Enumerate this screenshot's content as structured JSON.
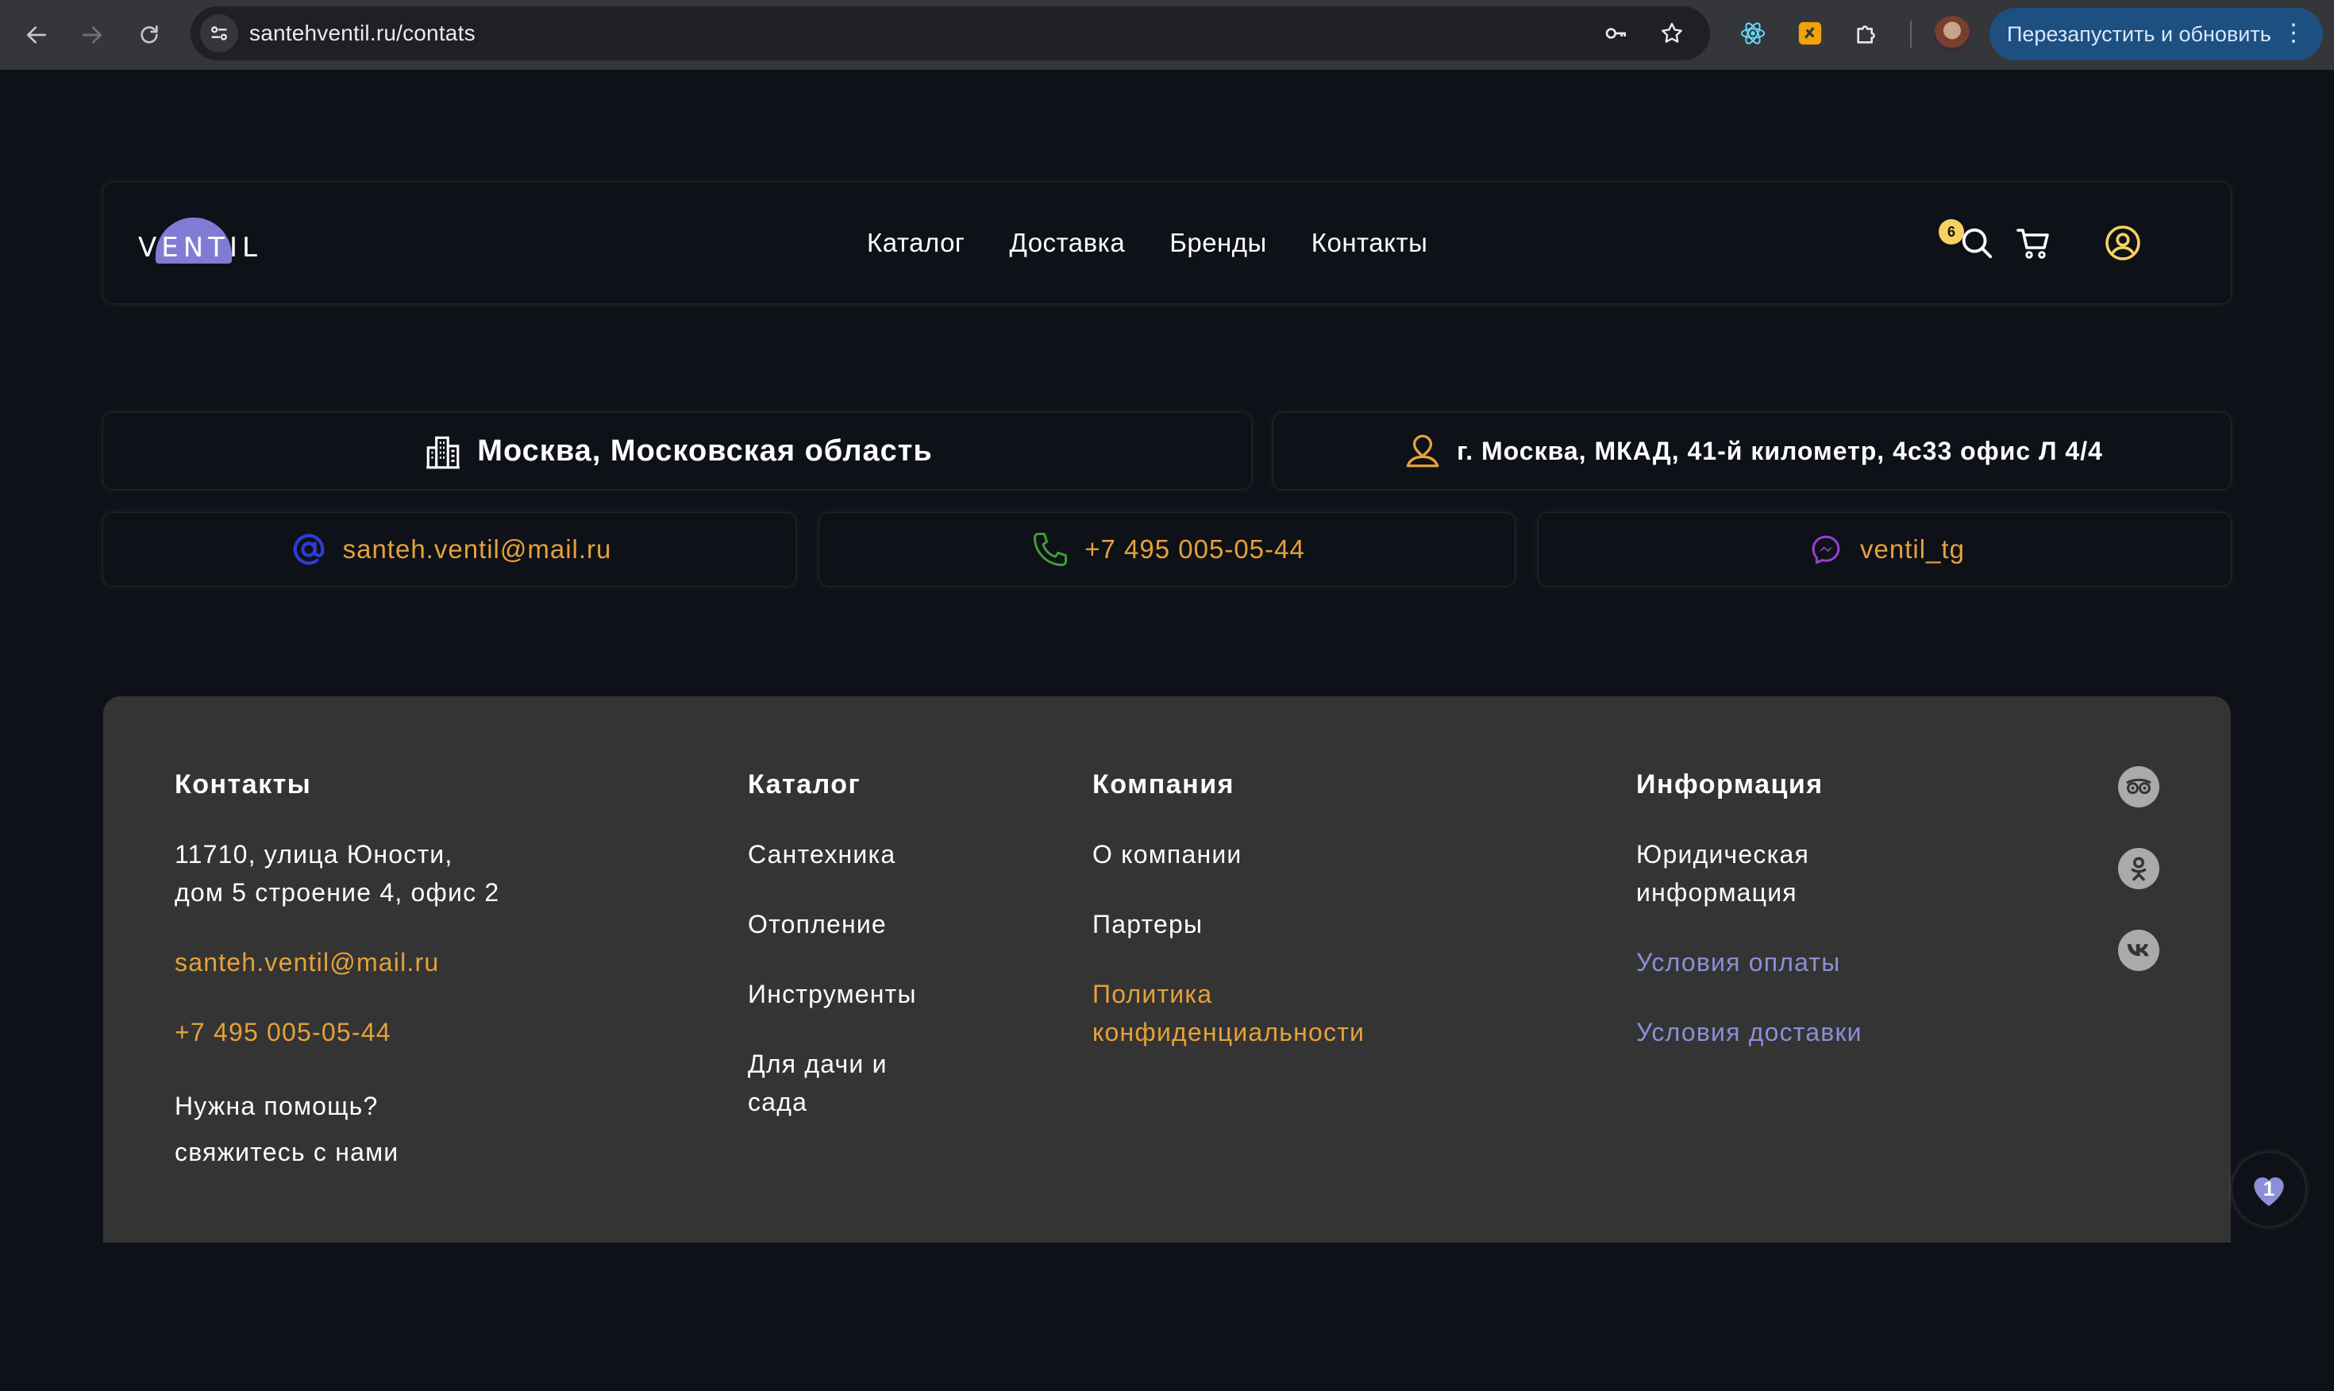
{
  "browser": {
    "url": "santehventil.ru/contats",
    "relaunch_label": "Перезапустить и обновить"
  },
  "header": {
    "logo_text": "VENTIL",
    "nav": [
      {
        "label": "Каталог"
      },
      {
        "label": "Доставка"
      },
      {
        "label": "Бренды"
      },
      {
        "label": "Контакты"
      }
    ],
    "cart_count": "6",
    "colors": {
      "cart_badge": "#f5d160",
      "logo_disc": "#8a86e6"
    }
  },
  "contacts": {
    "region": "Москва, Московская область",
    "address": "г. Москва, МКАД, 41-й километр, 4с33 офис Л 4/4",
    "email": "santeh.ventil@mail.ru",
    "phone": "+7 495 005-05-44",
    "telegram": "ventil_tg",
    "colors": {
      "accent": "#e5a13a",
      "email_icon": "#2f3bd6",
      "phone_icon": "#3f9a3a",
      "messenger_icon": "#9a3fd6",
      "address_icon": "#e5a13a"
    }
  },
  "footer": {
    "contacts": {
      "title": "Контакты",
      "address_line1": "11710, улица Юности,",
      "address_line2": "дом 5 строение 4, офис 2",
      "email": "santeh.ventil@mail.ru",
      "phone": "+7 495 005-05-44",
      "help_line1": "Нужна помощь?",
      "help_line2": "свяжитесь с нами"
    },
    "catalog": {
      "title": "Каталог",
      "items": [
        "Сантехника",
        "Отопление",
        "Инструменты"
      ],
      "garden_line1": "Для дачи и",
      "garden_line2": "сада"
    },
    "company": {
      "title": "Компания",
      "about": "О компании",
      "partners": "Партеры",
      "privacy_line1": "Политика",
      "privacy_line2": "конфиденциальности"
    },
    "info": {
      "title": "Информация",
      "legal_line1": "Юридическая",
      "legal_line2": "информация",
      "payment": "Условия оплаты",
      "delivery": "Условия доставки"
    },
    "social": [
      "tripadvisor-icon",
      "odnoklassniki-icon",
      "vk-icon"
    ],
    "colors": {
      "background": "#343434",
      "link_blue": "#8a8fd6"
    }
  },
  "favorites_count": "1"
}
